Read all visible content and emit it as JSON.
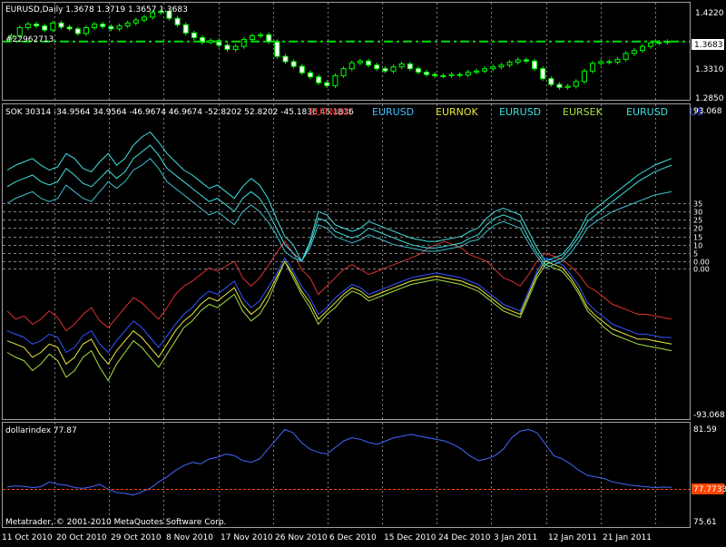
{
  "colors": {
    "background": "#000000",
    "frame": "#a0a0a0",
    "grid": "#808080",
    "candle": "#00ff00",
    "bid_line": "#00dd00",
    "eurnok_red": "#e03030",
    "eurusd_blue": "#3355ff",
    "eurnok_yellow": "#e8e840",
    "eurusd_cyan": "#40e0e0",
    "eursek_green": "#a8e040",
    "dollar_index": "#4466ff",
    "dollar_level": "#ff4400"
  },
  "main_panel": {
    "title": "EURUSD,Daily  1.3678 1.3719 1.3657 1.3683",
    "order_label": "#22962713",
    "price_ticks": [
      "1.4220",
      "1.3310",
      "1.2850"
    ],
    "bid_label": "1.3683"
  },
  "indicator_panel": {
    "header": "SOK 30314 -34.9564 34.9564 -46.9674 46.9674 -52.8202 52.8202 -45.1836 45.1836",
    "legend": [
      {
        "text": "EURNOK",
        "color": "#e03030"
      },
      {
        "text": "EURUSD",
        "color": "#40c0ff"
      },
      {
        "text": "EURNOK",
        "color": "#e8e840"
      },
      {
        "text": "EURUSD",
        "color": "#40e0e0"
      },
      {
        "text": "EURSEK",
        "color": "#a8e040"
      },
      {
        "text": "EURUSD",
        "color": "#40e0e0"
      },
      {
        "text": "US",
        "color": "#3355ff"
      }
    ],
    "scale_top": "93.068",
    "scale_bottom": "-93.068",
    "levels": [
      "35",
      "30",
      "25",
      "20",
      "15",
      "10",
      "5",
      "0.00",
      "0.00"
    ]
  },
  "dollar_panel": {
    "header": "dollarindex 77.87",
    "scale_top": "81.59",
    "scale_bottom": "75.61",
    "level_label": "77.7733",
    "copyright": "Metatrader, © 2001-2010 MetaQuotes Software Corp."
  },
  "time_axis": [
    "11 Oct 2010",
    "20 Oct 2010",
    "29 Oct 2010",
    "8 Nov 2010",
    "17 Nov 2010",
    "26 Nov 2010",
    "6 Dec 2010",
    "15 Dec 2010",
    "24 Dec 2010",
    "3 Jan 2011",
    "12 Jan 2011",
    "21 Jan 2011"
  ],
  "chart_data": [
    {
      "type": "candlestick",
      "title": "EURUSD,Daily",
      "ohlc_last": {
        "open": 1.3678,
        "high": 1.3719,
        "low": 1.3657,
        "close": 1.3683
      },
      "ylim": [
        1.275,
        1.43
      ],
      "close_series": [
        1.378,
        1.392,
        1.398,
        1.395,
        1.388,
        1.4,
        1.393,
        1.39,
        1.382,
        1.392,
        1.398,
        1.394,
        1.39,
        1.395,
        1.4,
        1.405,
        1.41,
        1.418,
        1.42,
        1.408,
        1.397,
        1.383,
        1.375,
        1.367,
        1.37,
        1.362,
        1.355,
        1.36,
        1.372,
        1.378,
        1.38,
        1.368,
        1.343,
        1.334,
        1.326,
        1.315,
        1.308,
        1.298,
        1.293,
        1.31,
        1.322,
        1.332,
        1.335,
        1.328,
        1.322,
        1.318,
        1.325,
        1.33,
        1.322,
        1.316,
        1.312,
        1.31,
        1.31,
        1.312,
        1.311,
        1.316,
        1.318,
        1.322,
        1.325,
        1.328,
        1.333,
        1.337,
        1.335,
        1.322,
        1.305,
        1.295,
        1.29,
        1.292,
        1.3,
        1.318,
        1.331,
        1.334,
        1.333,
        1.338,
        1.348,
        1.353,
        1.36,
        1.366,
        1.367,
        1.3683
      ]
    },
    {
      "type": "line",
      "title": "SOK 30314",
      "ylim": [
        -93.068,
        93.068
      ],
      "series": [
        {
          "name": "EURNOK",
          "color": "#e03030",
          "values": [
            -30,
            -35,
            -33,
            -38,
            -35,
            -30,
            -34,
            -42,
            -38,
            -32,
            -28,
            -36,
            -40,
            -34,
            -28,
            -22,
            -25,
            -30,
            -35,
            -28,
            -20,
            -15,
            -12,
            -8,
            -4,
            -6,
            -3,
            0,
            -10,
            -15,
            -10,
            -3,
            5,
            12,
            5,
            -5,
            -10,
            -20,
            -15,
            -10,
            -5,
            -2,
            -5,
            -8,
            -6,
            -4,
            -2,
            0,
            2,
            4,
            8,
            10,
            12,
            10,
            8,
            4,
            2,
            0,
            -5,
            -10,
            -12,
            -15,
            -8,
            0,
            5,
            3,
            1,
            -3,
            -8,
            -15,
            -18,
            -22,
            -26,
            -28,
            -30,
            -32,
            -32,
            -33,
            -34,
            -35
          ]
        },
        {
          "name": "EURUSD",
          "color": "#3355ff",
          "values": [
            -42,
            -44,
            -46,
            -50,
            -48,
            -44,
            -46,
            -55,
            -52,
            -45,
            -42,
            -50,
            -55,
            -48,
            -42,
            -36,
            -40,
            -46,
            -52,
            -45,
            -38,
            -32,
            -28,
            -22,
            -18,
            -20,
            -16,
            -12,
            -22,
            -28,
            -24,
            -16,
            -8,
            2,
            -6,
            -15,
            -22,
            -32,
            -28,
            -22,
            -18,
            -14,
            -16,
            -20,
            -18,
            -16,
            -14,
            -12,
            -10,
            -9,
            -8,
            -7,
            -8,
            -9,
            -10,
            -12,
            -14,
            -18,
            -22,
            -26,
            -28,
            -30,
            -18,
            -6,
            2,
            0,
            -2,
            -8,
            -15,
            -25,
            -30,
            -34,
            -38,
            -40,
            -42,
            -44,
            -44,
            -45,
            -46,
            -46
          ]
        },
        {
          "name": "EURNOK",
          "color": "#e8e840",
          "values": [
            -48,
            -50,
            -52,
            -58,
            -55,
            -50,
            -52,
            -62,
            -58,
            -50,
            -47,
            -56,
            -62,
            -54,
            -48,
            -42,
            -46,
            -52,
            -58,
            -50,
            -42,
            -36,
            -32,
            -26,
            -22,
            -24,
            -20,
            -16,
            -26,
            -32,
            -28,
            -20,
            -10,
            0,
            -8,
            -18,
            -25,
            -35,
            -30,
            -25,
            -20,
            -16,
            -18,
            -22,
            -20,
            -18,
            -16,
            -14,
            -12,
            -11,
            -10,
            -9,
            -10,
            -11,
            -12,
            -14,
            -16,
            -20,
            -24,
            -28,
            -30,
            -32,
            -20,
            -8,
            0,
            -2,
            -4,
            -10,
            -18,
            -28,
            -33,
            -37,
            -41,
            -43,
            -45,
            -47,
            -47,
            -48,
            -49,
            -50
          ]
        },
        {
          "name": "EURSEK",
          "color": "#a8e040",
          "values": [
            -55,
            -58,
            -60,
            -66,
            -62,
            -56,
            -60,
            -70,
            -66,
            -58,
            -54,
            -64,
            -72,
            -62,
            -55,
            -48,
            -52,
            -58,
            -64,
            -56,
            -48,
            -40,
            -36,
            -30,
            -26,
            -28,
            -24,
            -20,
            -30,
            -36,
            -32,
            -24,
            -12,
            0,
            -10,
            -20,
            -28,
            -38,
            -32,
            -28,
            -22,
            -18,
            -20,
            -24,
            -22,
            -20,
            -18,
            -16,
            -14,
            -13,
            -12,
            -11,
            -12,
            -13,
            -14,
            -16,
            -18,
            -22,
            -26,
            -30,
            -32,
            -34,
            -22,
            -10,
            -2,
            -4,
            -6,
            -12,
            -20,
            -30,
            -35,
            -40,
            -44,
            -46,
            -48,
            -50,
            -51,
            -52,
            -53,
            -54
          ]
        },
        {
          "name": "EURUSD",
          "color": "#40e0e0",
          "values": [
            55,
            58,
            60,
            62,
            58,
            55,
            57,
            65,
            62,
            56,
            54,
            60,
            65,
            58,
            62,
            70,
            75,
            78,
            72,
            65,
            60,
            55,
            52,
            48,
            44,
            46,
            42,
            38,
            45,
            50,
            46,
            38,
            26,
            15,
            10,
            0,
            12,
            30,
            28,
            22,
            20,
            18,
            20,
            24,
            22,
            20,
            18,
            16,
            14,
            13,
            12,
            12,
            13,
            14,
            15,
            18,
            20,
            26,
            30,
            32,
            30,
            28,
            18,
            8,
            0,
            2,
            4,
            10,
            18,
            28,
            32,
            36,
            40,
            44,
            48,
            52,
            55,
            58,
            60,
            62
          ]
        },
        {
          "name": "EURUSD",
          "color": "#40e0e0",
          "values": [
            45,
            48,
            50,
            52,
            48,
            46,
            48,
            56,
            52,
            47,
            45,
            50,
            55,
            50,
            54,
            62,
            66,
            70,
            64,
            56,
            52,
            48,
            44,
            40,
            36,
            38,
            34,
            30,
            38,
            42,
            38,
            30,
            20,
            10,
            5,
            0,
            10,
            26,
            24,
            18,
            16,
            14,
            16,
            20,
            18,
            16,
            14,
            12,
            10,
            9,
            8,
            8,
            9,
            10,
            11,
            14,
            16,
            22,
            26,
            28,
            26,
            24,
            14,
            5,
            -2,
            0,
            2,
            8,
            15,
            24,
            28,
            32,
            36,
            40,
            44,
            48,
            51,
            54,
            56,
            58
          ]
        },
        {
          "name": "US",
          "color": "#40c0d0",
          "values": [
            35,
            38,
            40,
            42,
            38,
            36,
            38,
            46,
            42,
            38,
            36,
            42,
            48,
            44,
            48,
            55,
            58,
            62,
            56,
            48,
            44,
            40,
            36,
            32,
            28,
            30,
            26,
            22,
            30,
            34,
            30,
            24,
            16,
            6,
            2,
            0,
            8,
            22,
            20,
            15,
            13,
            11,
            13,
            16,
            14,
            12,
            10,
            9,
            8,
            7,
            6,
            6,
            7,
            8,
            9,
            12,
            13,
            18,
            22,
            24,
            22,
            20,
            11,
            3,
            -4,
            -2,
            0,
            5,
            12,
            20,
            24,
            27,
            30,
            32,
            34,
            36,
            38,
            40,
            41,
            42
          ]
        }
      ]
    },
    {
      "type": "line",
      "title": "dollarindex",
      "ylim": [
        75.61,
        81.59
      ],
      "series": [
        {
          "name": "dollarindex",
          "color": "#4466ff",
          "values": [
            77.9,
            77.95,
            77.92,
            77.85,
            77.9,
            78.2,
            78.05,
            78.0,
            77.85,
            77.8,
            77.9,
            78.05,
            77.75,
            77.55,
            77.5,
            77.4,
            77.6,
            77.8,
            78.2,
            78.5,
            78.9,
            79.2,
            79.4,
            79.3,
            79.6,
            79.7,
            79.9,
            79.8,
            79.5,
            79.4,
            79.6,
            80.2,
            80.8,
            81.4,
            81.2,
            80.6,
            80.2,
            80.0,
            79.9,
            80.3,
            80.7,
            80.9,
            80.8,
            80.6,
            80.5,
            80.7,
            80.9,
            81.0,
            81.1,
            81.0,
            80.9,
            80.8,
            80.7,
            80.5,
            80.2,
            79.8,
            79.5,
            79.6,
            79.8,
            80.2,
            80.9,
            81.3,
            81.4,
            81.2,
            80.5,
            79.8,
            79.6,
            79.3,
            78.9,
            78.6,
            78.5,
            78.4,
            78.2,
            78.1,
            78.0,
            77.95,
            77.9,
            77.85,
            77.88,
            77.87
          ]
        },
        {
          "name": "level",
          "color": "#ff4400",
          "values": [
            77.7733
          ]
        }
      ]
    }
  ]
}
